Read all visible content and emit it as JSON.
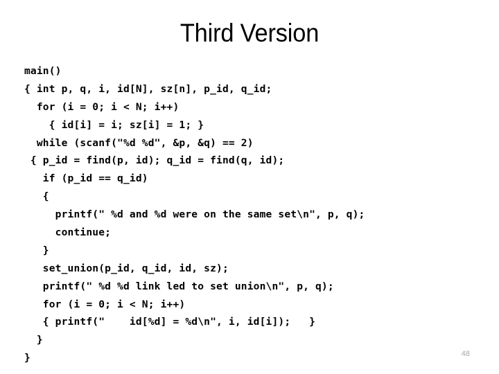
{
  "slide": {
    "title": "Third Version",
    "page_number": "48",
    "colors": {
      "background": "#ffffff",
      "text": "#000000",
      "page_number": "#a6a6a6"
    }
  },
  "code": {
    "language": "c",
    "lines": [
      "main()",
      "{ int p, q, i, id[N], sz[n], p_id, q_id;",
      "  for (i = 0; i < N; i++)",
      "    { id[i] = i; sz[i] = 1; }",
      "  while (scanf(\"%d %d\", &p, &q) == 2)",
      " { p_id = find(p, id); q_id = find(q, id);",
      "   if (p_id == q_id)",
      "   {",
      "     printf(\" %d and %d were on the same set\\n\", p, q);",
      "     continue;",
      "   }",
      "   set_union(p_id, q_id, id, sz);",
      "   printf(\" %d %d link led to set union\\n\", p, q);",
      "   for (i = 0; i < N; i++)",
      "   { printf(\"    id[%d] = %d\\n\", i, id[i]);   }",
      "  }",
      "}"
    ]
  }
}
